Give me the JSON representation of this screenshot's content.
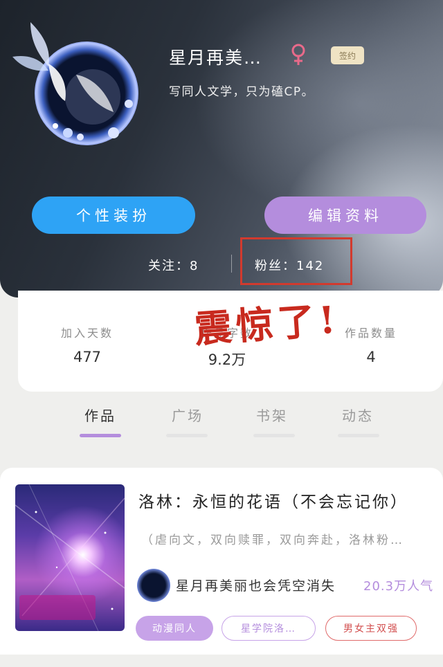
{
  "profile": {
    "nickname": "星月再美…",
    "gender": "female-icon",
    "badge": "签约",
    "bio": "写同人文学，只为磕CP。"
  },
  "actions": {
    "dress_label": "个性装扮",
    "edit_label": "编辑资料"
  },
  "social": {
    "follow": "关注：8",
    "fans": "粉丝：142"
  },
  "annotation": {
    "shock": "震惊了!"
  },
  "stats": [
    {
      "label": "加入天数",
      "value": "477"
    },
    {
      "label": "作品字数",
      "value": "9.2万"
    },
    {
      "label": "作品数量",
      "value": "4"
    }
  ],
  "tabs": [
    {
      "label": "作品",
      "active": true
    },
    {
      "label": "广场",
      "active": false
    },
    {
      "label": "书架",
      "active": false
    },
    {
      "label": "动态",
      "active": false
    }
  ],
  "work": {
    "title": "洛林：永恒的花语（不会忘记你）",
    "tags_line": "（虐向文，双向赎罪，双向奔赴，洛林粉…",
    "author": "星月再美丽也会凭空消失",
    "popularity": "20.3万人气",
    "chips": [
      "动漫同人",
      "星学院洛…",
      "男女主双强"
    ]
  },
  "colors": {
    "accent_purple": "#b48ddd",
    "accent_blue": "#2ea3f5",
    "highlight_red": "#d23a2e"
  }
}
